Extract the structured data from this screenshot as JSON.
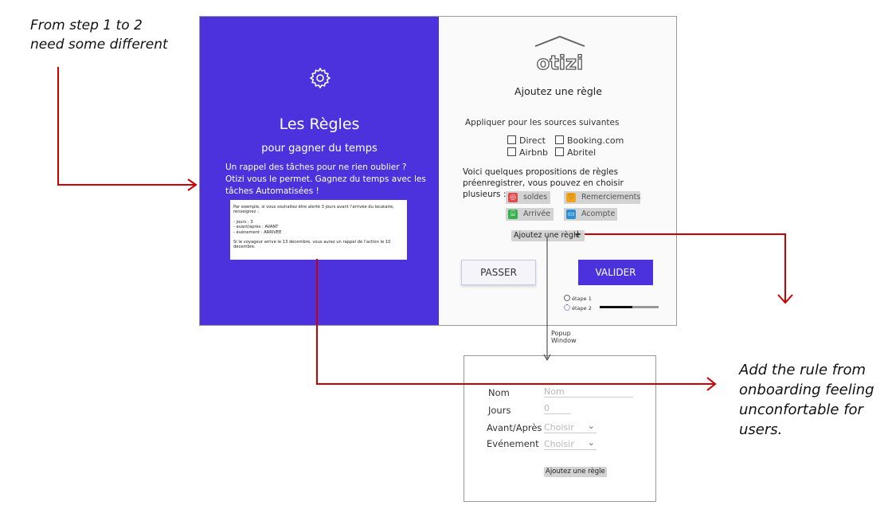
{
  "notes": {
    "top_left": [
      "From step 1 to 2",
      "need some different"
    ],
    "right": [
      "Add the rule from",
      "onboarding feeling",
      "unconfortable for",
      "users."
    ]
  },
  "left_panel": {
    "title": "Les Règles",
    "subtitle": "pour gagner du temps",
    "intro": [
      "Un rappel des tâches pour ne rien oublier ?",
      "Otizi vous le permet. Gagnez du temps avec les",
      "tâches Automatisées !"
    ],
    "example": {
      "line1": "Par exemple, si vous souhaitez être alerté 3 jours avant l’arrivée du locataire, renseignez :",
      "items": [
        "- jours : 3",
        "- avant/après : AVANT",
        "- événement : ARRIVEE"
      ],
      "line2": "Si le voyageur arrive le 13 décembre, vous aurez un rappel de l’action le 10 décembre."
    },
    "icon": "gear-icon",
    "bg_color": "#4b32dc"
  },
  "right_panel": {
    "logo": "otizi",
    "title": "Ajoutez une règle",
    "sources_heading": "Appliquer pour les sources suivantes",
    "sources": [
      "Direct",
      "Booking.com",
      "Airbnb",
      "Abritel"
    ],
    "proposals_text": [
      "Voici quelques propositions de règles",
      "préenregistrer, vous pouvez en choisir",
      "plusieurs :"
    ],
    "chips": [
      {
        "label": "soldes",
        "icon": "tag-icon",
        "color": "#e2474b"
      },
      {
        "label": "Remerciements",
        "icon": "heart-icon",
        "color": "#f2a51a"
      },
      {
        "label": "Arrivée",
        "icon": "door-icon",
        "color": "#35b04a"
      },
      {
        "label": "Acompte",
        "icon": "card-icon",
        "color": "#2b8fd6"
      }
    ],
    "add_rule_label": "Ajoutez une règle",
    "add_rule_plus": "+",
    "skip_label": "PASSER",
    "validate_label": "VALIDER",
    "steps": [
      {
        "label": "étape 1",
        "state": "done"
      },
      {
        "label": "étape 2",
        "state": "current"
      }
    ],
    "progress": 0.55
  },
  "popup": {
    "caption": [
      "Popup",
      "Window"
    ],
    "fields": [
      {
        "label": "Nom",
        "placeholder": "Nom"
      },
      {
        "label": "Jours",
        "placeholder": "0"
      },
      {
        "label": "Avant/Après",
        "placeholder": "Choisir"
      },
      {
        "label": "Evénement",
        "placeholder": "Choisir"
      }
    ],
    "submit_label": "Ajoutez une règle"
  },
  "colors": {
    "accent": "#4b32dc",
    "arrow": "#cc0000"
  }
}
